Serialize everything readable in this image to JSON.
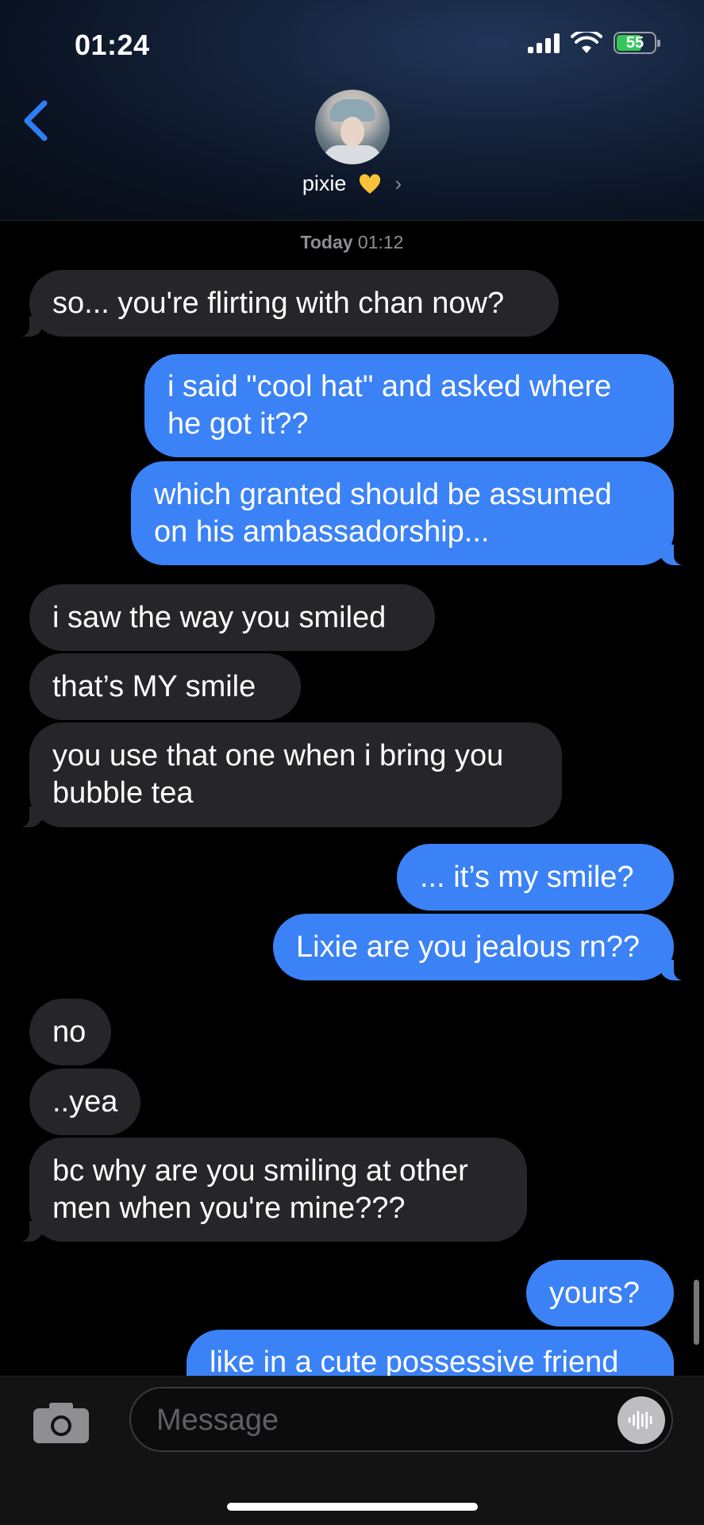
{
  "status_bar": {
    "time": "01:24",
    "battery": "55"
  },
  "header": {
    "contact_name": "pixie"
  },
  "timestamp": {
    "day": "Today",
    "time": "01:12"
  },
  "messages": [
    {
      "dir": "in",
      "lines": [
        "so... you're flirting with chan now?"
      ]
    },
    {
      "dir": "out",
      "lines": [
        "i said \"cool hat\" and asked where",
        "he got it??"
      ]
    },
    {
      "dir": "out",
      "lines": [
        "which granted should be assumed",
        "on his ambassadorship..."
      ]
    },
    {
      "dir": "in",
      "lines": [
        "i saw the way you smiled"
      ]
    },
    {
      "dir": "in",
      "lines": [
        "that’s MY smile"
      ]
    },
    {
      "dir": "in",
      "lines": [
        "you use that one when i bring you",
        "bubble tea"
      ]
    },
    {
      "dir": "out",
      "lines": [
        "... it’s my smile?"
      ]
    },
    {
      "dir": "out",
      "lines": [
        "Lixie are you jealous rn??"
      ]
    },
    {
      "dir": "in",
      "lines": [
        "no"
      ]
    },
    {
      "dir": "in",
      "lines": [
        "..yea"
      ]
    },
    {
      "dir": "in",
      "lines": [
        "bc why are you smiling at other",
        "men when you're mine???"
      ]
    },
    {
      "dir": "out",
      "lines": [
        "yours?"
      ]
    },
    {
      "dir": "out",
      "lines": [
        "like in a cute possessive friend"
      ]
    }
  ],
  "composer": {
    "placeholder": "Message"
  },
  "colors": {
    "outgoing": "#3b82f6",
    "incoming": "#26262a",
    "battery_fill": "#34c759"
  },
  "icons": {
    "back": "chevron-left-icon",
    "camera": "camera-icon",
    "voice": "waveform-icon",
    "heart": "yellow-heart-icon"
  }
}
